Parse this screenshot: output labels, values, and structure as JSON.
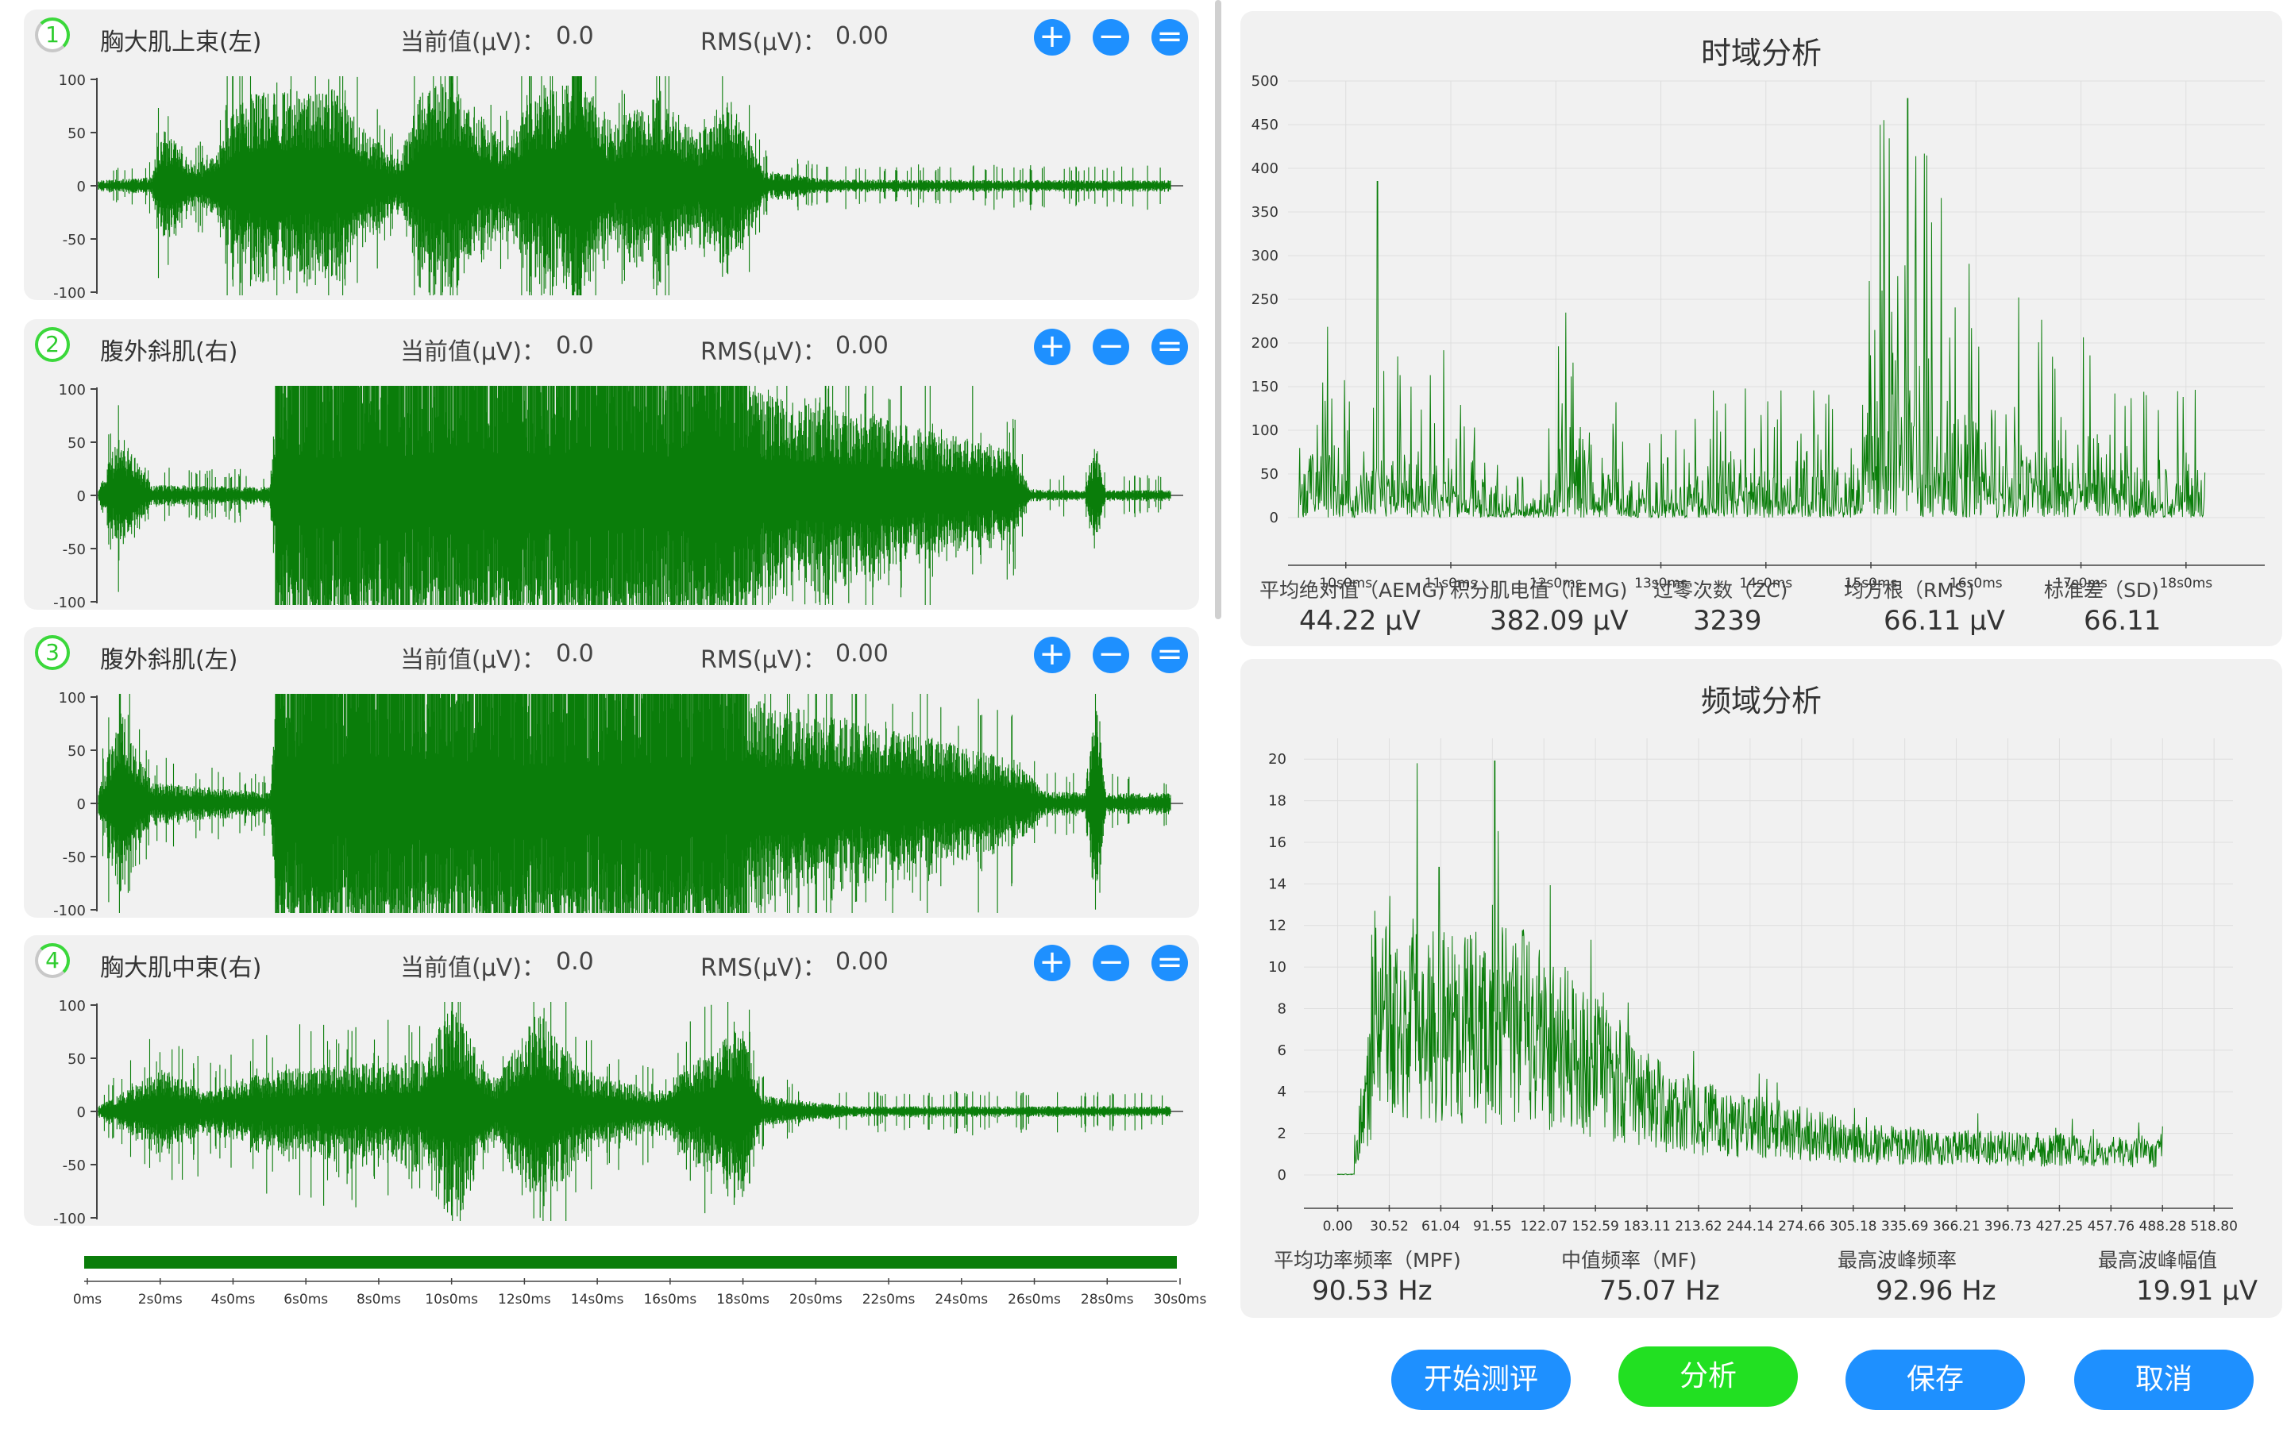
{
  "channels": [
    {
      "num": "1",
      "name": "胸大肌上束(左)",
      "cur_label": "当前值(μV)：",
      "cur_value": "0.0",
      "rms_label": "RMS(μV)：",
      "rms_value": "0.00",
      "style": "grey"
    },
    {
      "num": "2",
      "name": "腹外斜肌(右)",
      "cur_label": "当前值(μV)：",
      "cur_value": "0.0",
      "rms_label": "RMS(μV)：",
      "rms_value": "0.00",
      "style": "green"
    },
    {
      "num": "3",
      "name": "腹外斜肌(左)",
      "cur_label": "当前值(μV)：",
      "cur_value": "0.0",
      "rms_label": "RMS(μV)：",
      "rms_value": "0.00",
      "style": "green"
    },
    {
      "num": "4",
      "name": "胸大肌中束(右)",
      "cur_label": "当前值(μV)：",
      "cur_value": "0.0",
      "rms_label": "RMS(μV)：",
      "rms_value": "0.00",
      "style": "grey"
    }
  ],
  "channel_controls": {
    "plus": "+",
    "minus": "−",
    "menu": "="
  },
  "channel_yticks": [
    "100",
    "50",
    "0",
    "-50",
    "-100"
  ],
  "timeline": {
    "ticks": [
      "0ms",
      "2s0ms",
      "4s0ms",
      "6s0ms",
      "8s0ms",
      "10s0ms",
      "12s0ms",
      "14s0ms",
      "16s0ms",
      "18s0ms",
      "20s0ms",
      "22s0ms",
      "24s0ms",
      "26s0ms",
      "28s0ms",
      "30s0ms"
    ],
    "progress": 1.0
  },
  "time_domain": {
    "title": "时域分析",
    "chart_data": {
      "type": "line",
      "yticks": [
        "500",
        "450",
        "400",
        "350",
        "300",
        "250",
        "200",
        "150",
        "100",
        "50",
        "0"
      ],
      "ylim": [
        0,
        500
      ],
      "xticks": [
        "10s0ms",
        "11s0ms",
        "12s0ms",
        "13s0ms",
        "14s0ms",
        "15s0ms",
        "16s0ms",
        "17s0ms",
        "18s0ms"
      ],
      "xlim": [
        9.45,
        18.75
      ],
      "data_range": [
        9.55,
        18.18
      ],
      "peak": 480
    },
    "stats": [
      {
        "label": "平均绝对值（AEMG)",
        "value": "44.22 μV"
      },
      {
        "label": "积分肌电值（iEMG)",
        "value": "382.09 μV"
      },
      {
        "label": "过零次数（ZC)",
        "value": "3239"
      },
      {
        "label": "均方根（RMS)",
        "value": "66.11 μV"
      },
      {
        "label": "标准差（SD)",
        "value": "66.11"
      }
    ]
  },
  "freq_domain": {
    "title": "频域分析",
    "chart_data": {
      "type": "line",
      "yticks": [
        "20",
        "18",
        "16",
        "14",
        "12",
        "10",
        "8",
        "6",
        "4",
        "2",
        "0"
      ],
      "ylim": [
        0,
        21
      ],
      "xticks": [
        "0.00",
        "30.52",
        "61.04",
        "91.55",
        "122.07",
        "152.59",
        "183.11",
        "213.62",
        "244.14",
        "274.66",
        "305.18",
        "335.69",
        "366.21",
        "396.73",
        "427.25",
        "457.76",
        "488.28",
        "518.80"
      ],
      "xlim": [
        -20,
        530
      ],
      "peak": 19.91
    },
    "stats": [
      {
        "label": "平均功率频率（MPF)",
        "value": "90.53 Hz"
      },
      {
        "label": "中值频率（MF)",
        "value": "75.07 Hz"
      },
      {
        "label": "最高波峰频率",
        "value": "92.96 Hz"
      },
      {
        "label": "最高波峰幅值",
        "value": "19.91 μV"
      }
    ]
  },
  "actions": [
    "开始测评",
    "分析",
    "保存",
    "取消"
  ],
  "colors": {
    "signal": "#0a7d0a",
    "accent": "#1e90ff",
    "active": "#22e022",
    "panel": "#f1f1f1"
  }
}
